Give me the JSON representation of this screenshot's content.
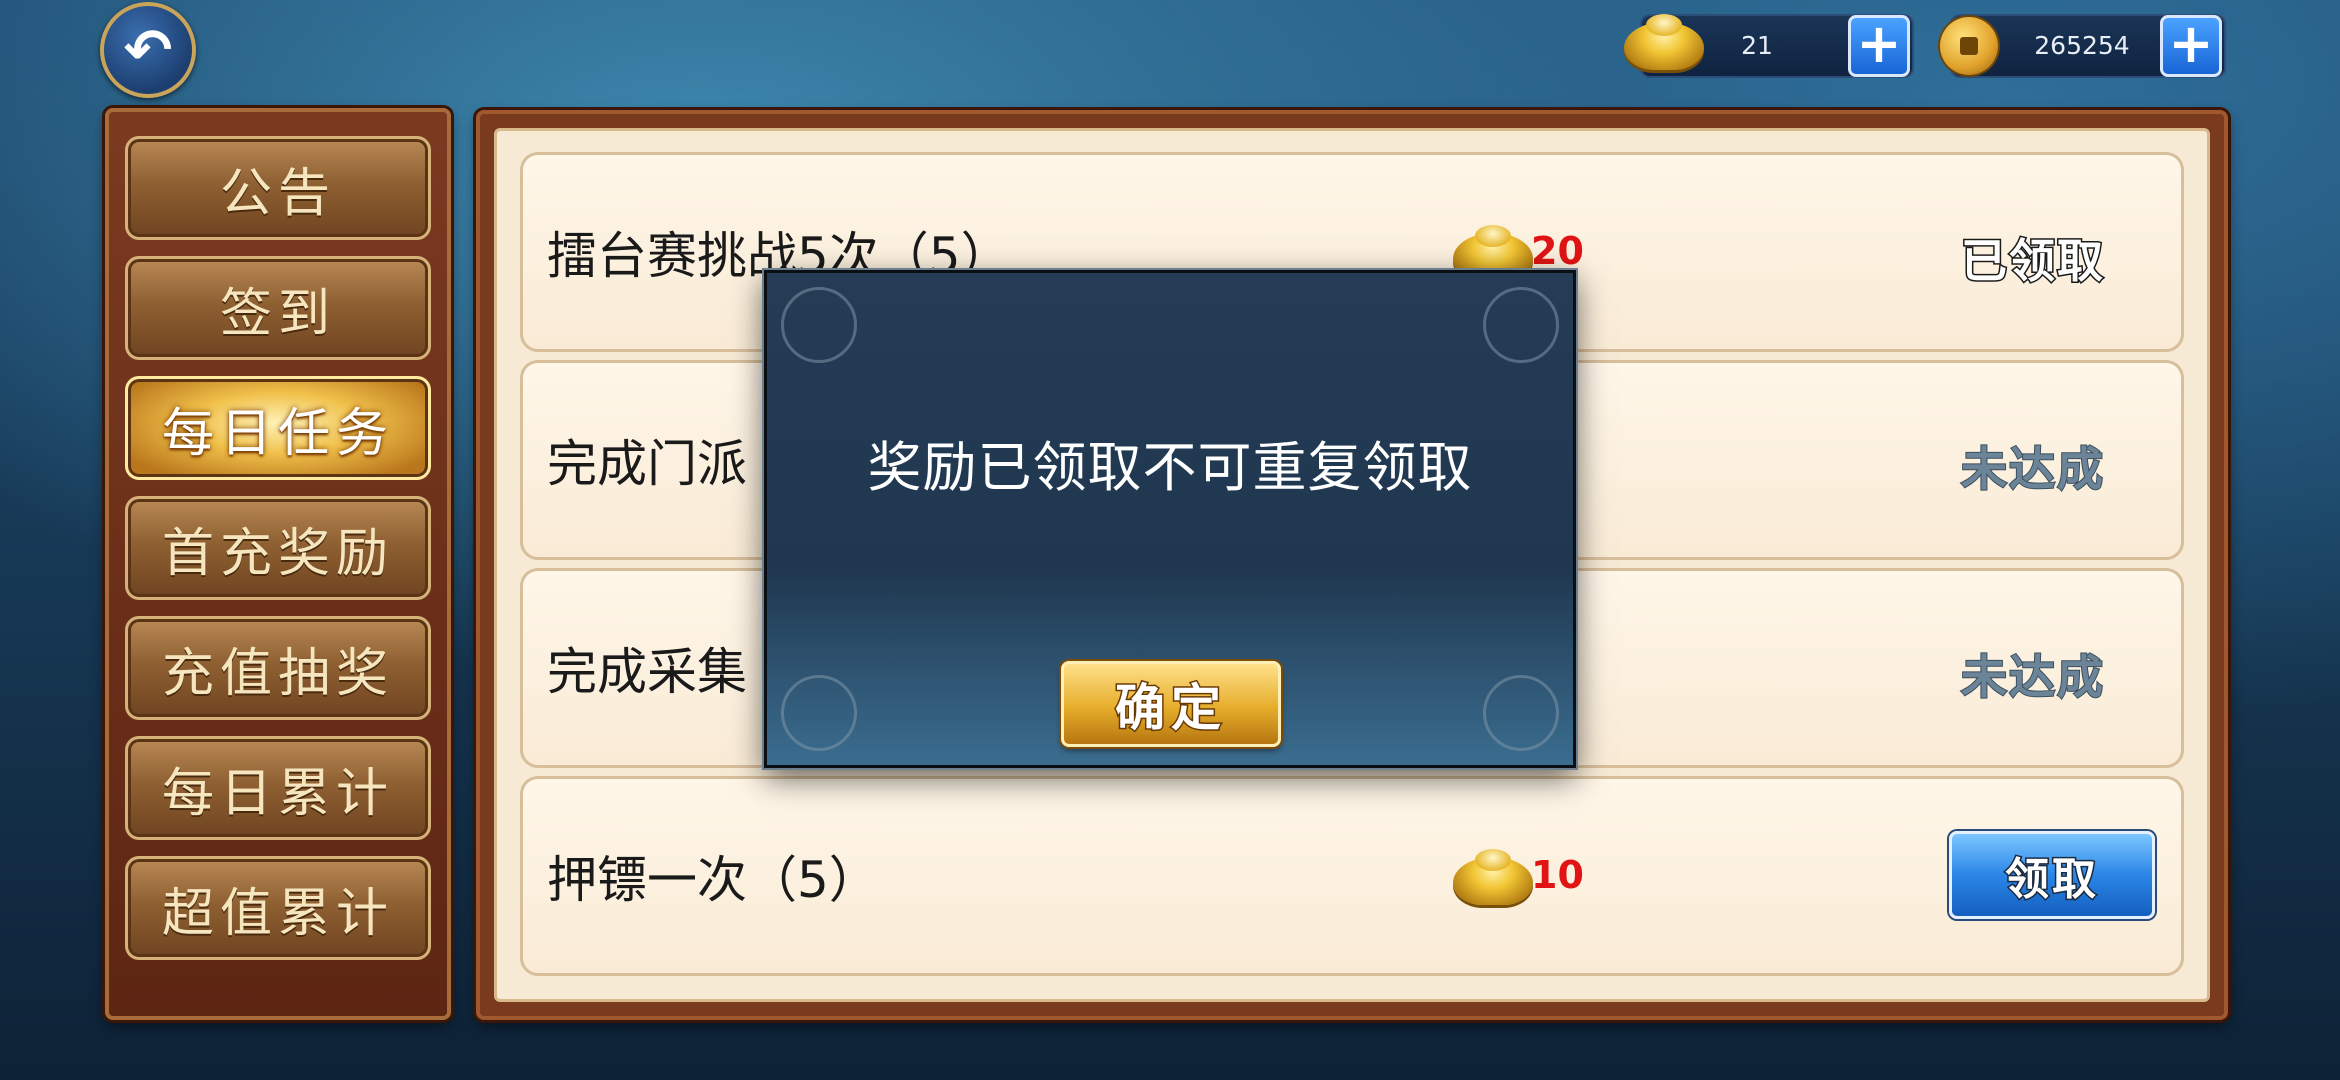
{
  "top_bar": {
    "back_icon": "back-arrow-icon",
    "gold_ingot": {
      "icon": "gold-ingot-icon",
      "value": "21"
    },
    "copper_coin": {
      "icon": "copper-coin-icon",
      "value": "265254"
    },
    "plus_label": "+"
  },
  "side_menu": {
    "items": [
      {
        "label": "公告"
      },
      {
        "label": "签到"
      },
      {
        "label": "每日任务",
        "active": true
      },
      {
        "label": "首充奖励"
      },
      {
        "label": "充值抽奖"
      },
      {
        "label": "每日累计"
      },
      {
        "label": "超值累计"
      }
    ]
  },
  "tasks": [
    {
      "name": "擂台赛挑战5次（5）",
      "reward": "20",
      "status": "已领取"
    },
    {
      "name": "完成门派",
      "reward": "",
      "status": "未达成"
    },
    {
      "name": "完成采集",
      "reward": "",
      "status": "未达成"
    },
    {
      "name": "押镖一次（5）",
      "reward": "10",
      "action": "领取"
    }
  ],
  "modal": {
    "message": "奖励已领取不可重复领取",
    "confirm_label": "确定"
  },
  "colors": {
    "reward_red": "#e01414",
    "menu_brown": "#7b3a20",
    "panel_cream": "#f7ead5",
    "modal_blue": "#243c55"
  }
}
